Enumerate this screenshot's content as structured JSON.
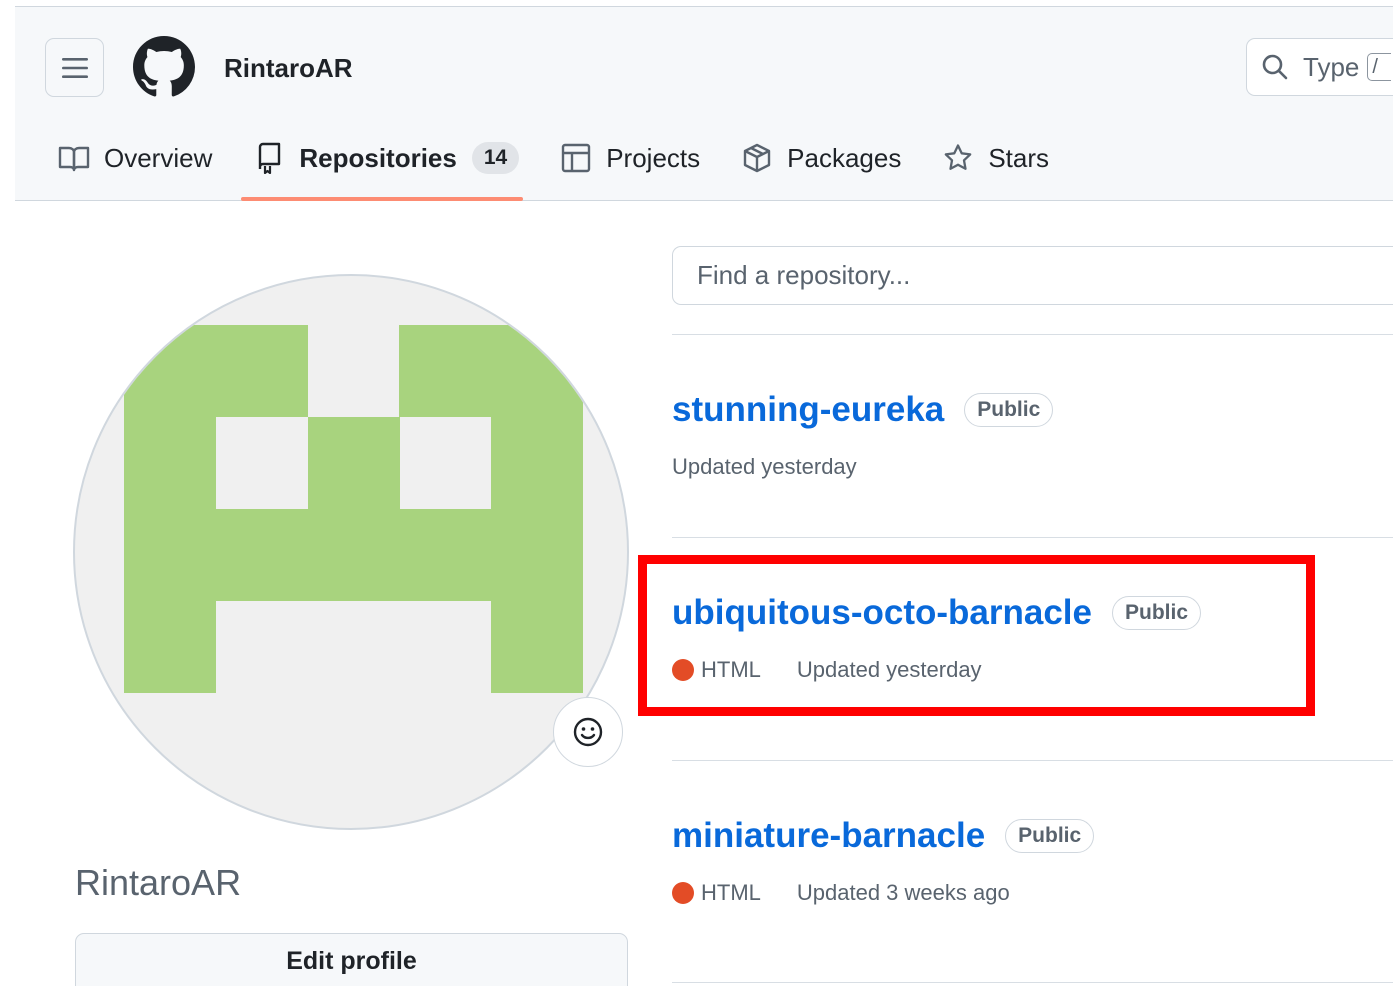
{
  "header": {
    "username": "RintaroAR",
    "search_placeholder": "Type",
    "search_kbd": "/"
  },
  "tabs": [
    {
      "label": "Overview",
      "icon": "book-icon"
    },
    {
      "label": "Repositories",
      "icon": "repo-icon",
      "count": "14",
      "selected": true
    },
    {
      "label": "Projects",
      "icon": "table-icon"
    },
    {
      "label": "Packages",
      "icon": "package-icon"
    },
    {
      "label": "Stars",
      "icon": "star-icon"
    }
  ],
  "profile": {
    "name": "RintaroAR",
    "edit_label": "Edit profile"
  },
  "repo_search": {
    "placeholder": "Find a repository..."
  },
  "repos": [
    {
      "name": "stunning-eureka",
      "visibility": "Public",
      "updated": "Updated yesterday"
    },
    {
      "name": "ubiquitous-octo-barnacle",
      "visibility": "Public",
      "language": "HTML",
      "updated": "Updated yesterday"
    },
    {
      "name": "miniature-barnacle",
      "visibility": "Public",
      "language": "HTML",
      "updated": "Updated 3 weeks ago"
    }
  ],
  "colors": {
    "accent_link": "#0969da",
    "tab_underline": "#fd8c73",
    "html_language": "#e34c26",
    "avatar_green": "#a8d37e",
    "highlight": "#ff0000"
  }
}
